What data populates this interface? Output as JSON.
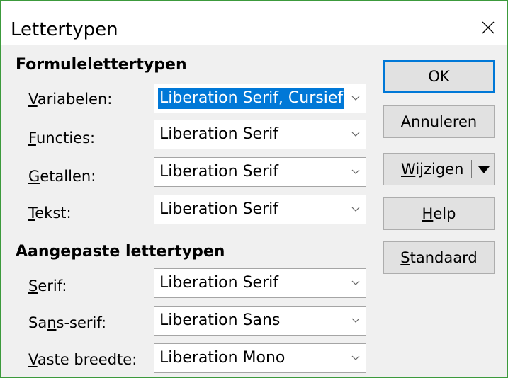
{
  "window": {
    "title": "Lettertypen"
  },
  "sections": {
    "formula_heading": "Formulelettertypen",
    "custom_heading": "Aangepaste lettertypen"
  },
  "formula_fonts": [
    {
      "label_mnemonic": "V",
      "label_rest": "ariabelen:",
      "value": "Liberation Serif, Cursief",
      "selected": true
    },
    {
      "label_mnemonic": "F",
      "label_rest": "uncties:",
      "value": "Liberation Serif",
      "selected": false
    },
    {
      "label_mnemonic": "G",
      "label_rest": "etallen:",
      "value": "Liberation Serif",
      "selected": false
    },
    {
      "label_mnemonic": "T",
      "label_rest": "ekst:",
      "value": "Liberation Serif",
      "selected": false
    }
  ],
  "custom_fonts": [
    {
      "label_mnemonic": "S",
      "label_rest": "erif:",
      "value": "Liberation Serif"
    },
    {
      "label_pre": "Sa",
      "label_mnemonic": "n",
      "label_rest": "s-serif:",
      "value": "Liberation Sans"
    },
    {
      "label_mnemonic": "V",
      "label_rest": "aste breedte:",
      "value": "Liberation Mono"
    }
  ],
  "buttons": {
    "ok": "OK",
    "cancel": "Annuleren",
    "modify_mnemonic": "W",
    "modify_rest": "ijzigen",
    "help_mnemonic": "H",
    "help_rest": "elp",
    "default_mnemonic": "S",
    "default_rest": "tandaard"
  },
  "colors": {
    "selection": "#0078d7",
    "dialog_bg": "#f0f0f0",
    "window_border": "#3c9a3c"
  },
  "icons": {
    "close": "close-icon",
    "combo_arrow": "chevron-down-icon",
    "split_arrow": "caret-down-icon"
  }
}
